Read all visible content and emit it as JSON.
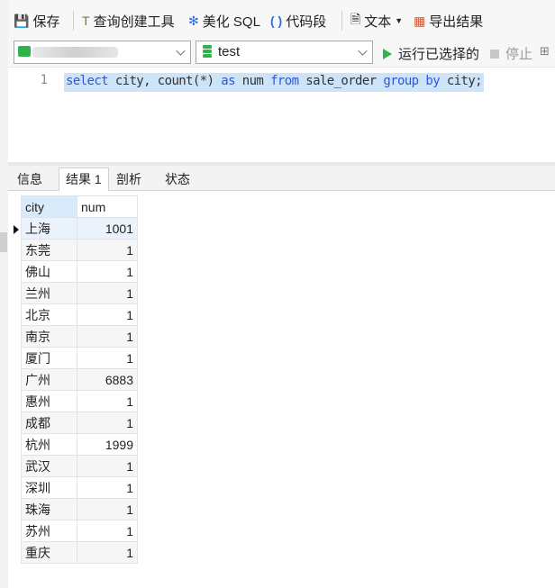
{
  "toolbar": {
    "save": "保存",
    "query_builder": "查询创建工具",
    "beautify": "美化 SQL",
    "snippet": "代码段",
    "text": "文本",
    "export": "导出结果"
  },
  "selectors": {
    "database": "test",
    "run_selected": "运行已选择的",
    "stop": "停止"
  },
  "editor": {
    "line_number": "1",
    "sql": [
      {
        "t": "select",
        "kw": true
      },
      {
        "t": " city, count(*) ",
        "kw": false
      },
      {
        "t": "as",
        "kw": true
      },
      {
        "t": " num ",
        "kw": false
      },
      {
        "t": "from",
        "kw": true
      },
      {
        "t": " sale_order ",
        "kw": false
      },
      {
        "t": "group",
        "kw": true
      },
      {
        "t": " ",
        "kw": false
      },
      {
        "t": "by",
        "kw": true
      },
      {
        "t": " city;",
        "kw": false
      }
    ]
  },
  "tabs": [
    "信息",
    "结果 1",
    "剖析",
    "状态"
  ],
  "result": {
    "columns": [
      "city",
      "num"
    ],
    "rows": [
      [
        "上海",
        "1001"
      ],
      [
        "东莞",
        "1"
      ],
      [
        "佛山",
        "1"
      ],
      [
        "兰州",
        "1"
      ],
      [
        "北京",
        "1"
      ],
      [
        "南京",
        "1"
      ],
      [
        "厦门",
        "1"
      ],
      [
        "广州",
        "6883"
      ],
      [
        "惠州",
        "1"
      ],
      [
        "成都",
        "1"
      ],
      [
        "杭州",
        "1999"
      ],
      [
        "武汉",
        "1"
      ],
      [
        "深圳",
        "1"
      ],
      [
        "珠海",
        "1"
      ],
      [
        "苏州",
        "1"
      ],
      [
        "重庆",
        "1"
      ]
    ]
  },
  "colors": {
    "keyword": "#2f57d8",
    "selection": "#cde3f7",
    "run_green": "#2fb34a"
  }
}
